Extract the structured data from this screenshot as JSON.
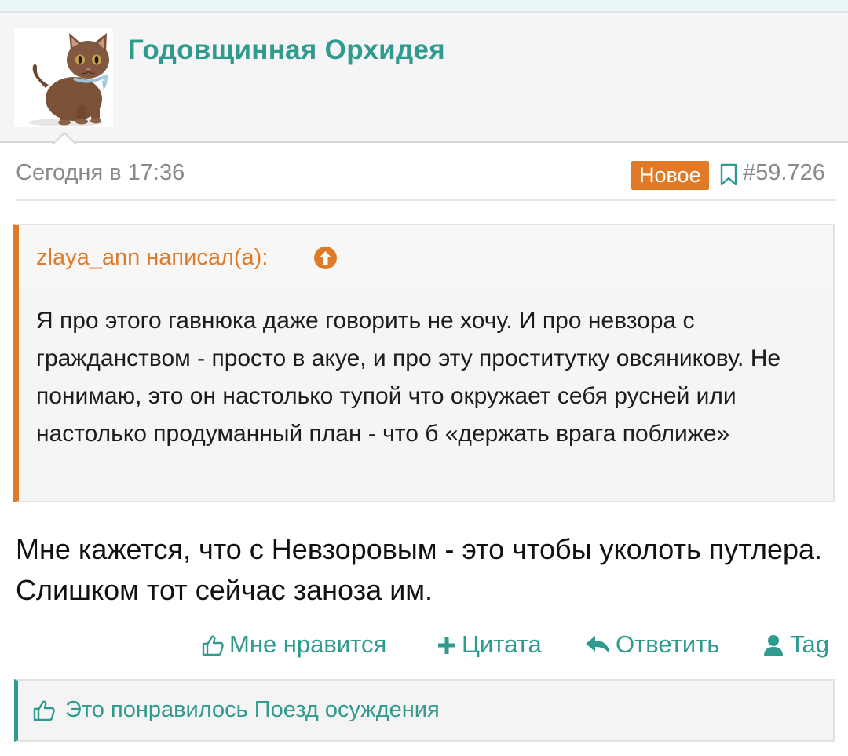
{
  "post": {
    "author": "Годовщинная Орхидея",
    "date": "Сегодня в 17:36",
    "badge": "Новое",
    "number": "#59.726",
    "quote": {
      "author_line": "zlaya_ann написал(а):",
      "text": "Я про этого гавнюка даже говорить не хочу. И про невзора с гражданством - просто в акуе, и про эту проститутку овсяникову. Не понимаю, это он настолько тупой что окружает себя русней или настолько продуманный план - что б «держать врага поближе»"
    },
    "text": "Мне кажется, что с Невзоровым - это чтобы уколоть путлера. Слишком тот сейчас заноза им."
  },
  "actions": {
    "like": "Мне нравится",
    "quote": "Цитата",
    "reply": "Ответить",
    "tag": "Tag"
  },
  "likes": {
    "text": "Это понравилось Поезд осуждения"
  },
  "colors": {
    "accent": "#2f9a8e",
    "quote_accent": "#e07a27",
    "badge_bg": "#e07a27",
    "muted": "#8a8a8a"
  },
  "icons": [
    "kitten-avatar",
    "bookmark-icon",
    "arrow-up-circle-icon",
    "thumbs-up-icon",
    "plus-icon",
    "reply-icon",
    "user-icon"
  ]
}
